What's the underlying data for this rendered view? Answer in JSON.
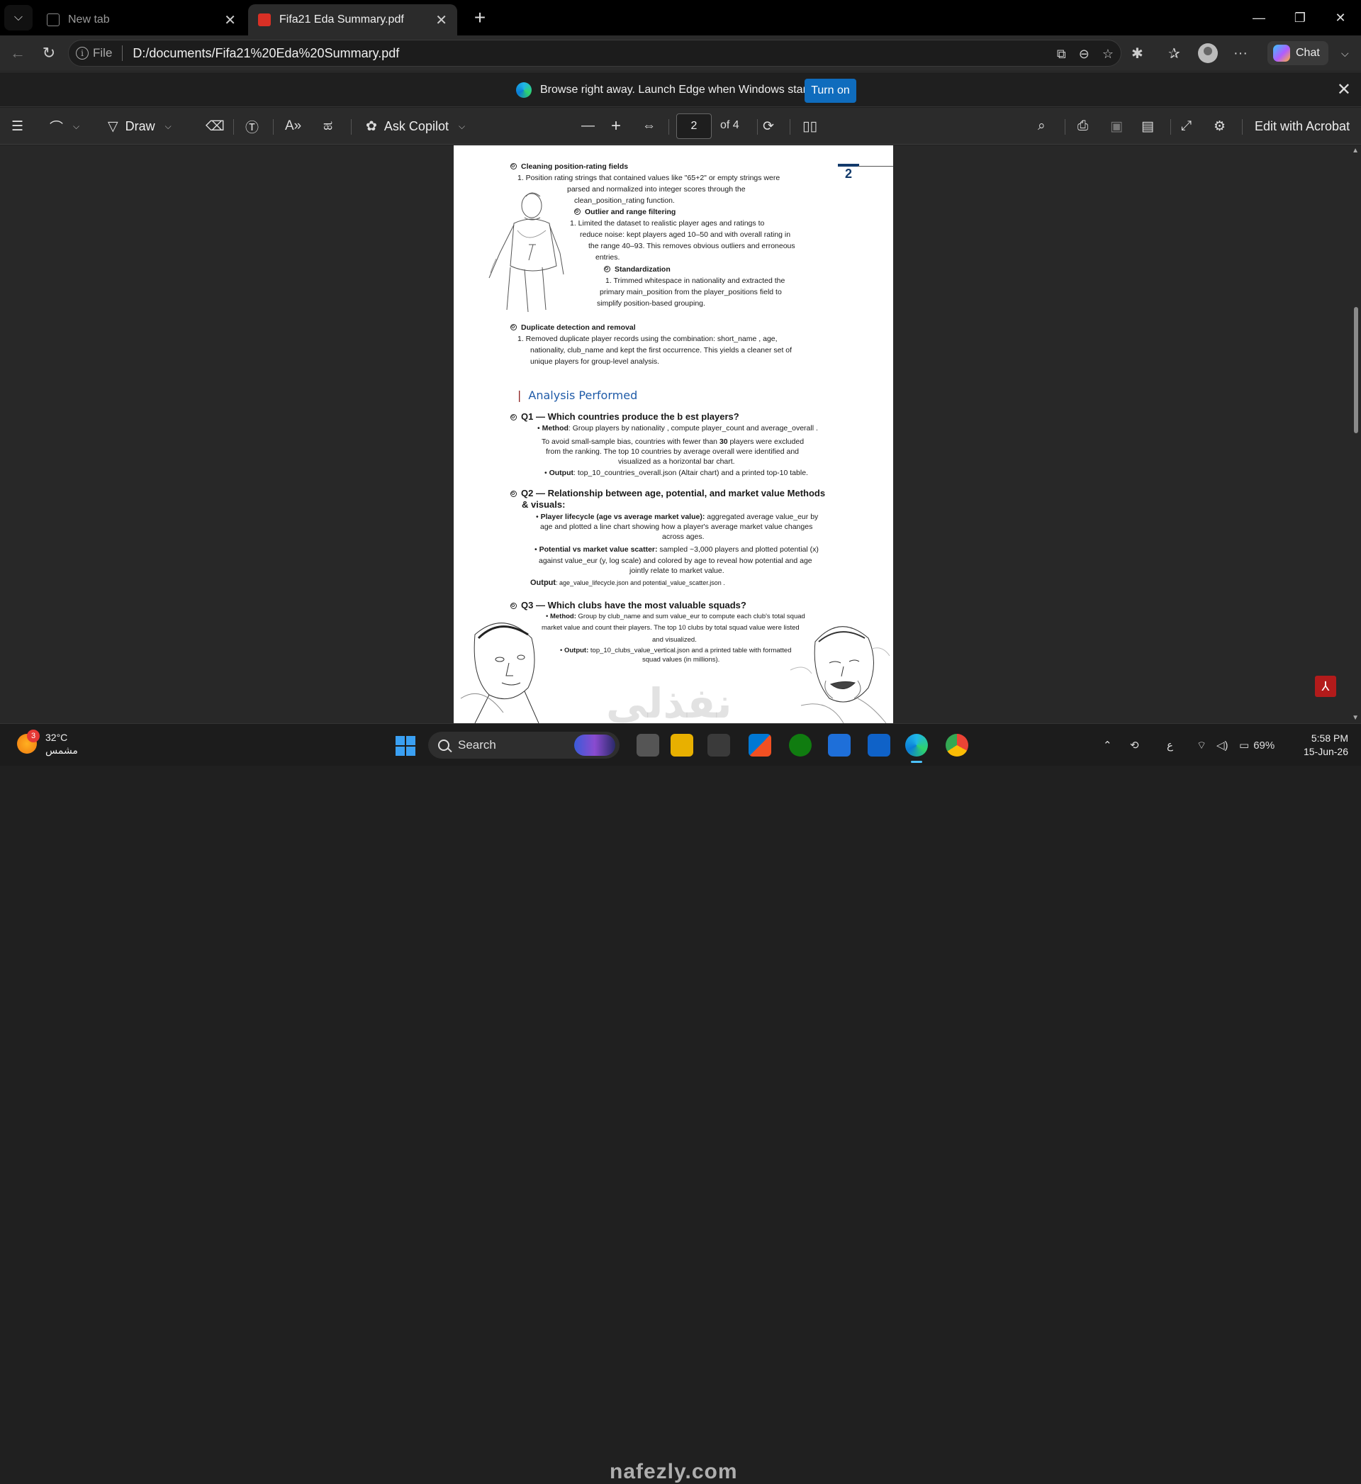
{
  "tabs": [
    {
      "title": "New tab",
      "active": false
    },
    {
      "title": "Fifa21 Eda Summary.pdf",
      "active": true
    }
  ],
  "address": {
    "scheme_label": "File",
    "url": "D:/documents/Fifa21%20Eda%20Summary.pdf"
  },
  "chat_label": "Chat",
  "infobar": {
    "message": "Browse right away. Launch Edge when Windows starts.",
    "button": "Turn on"
  },
  "pdf_toolbar": {
    "draw_label": "Draw",
    "ask_copilot_label": "Ask Copilot",
    "current_page": "2",
    "page_of": "of 4",
    "edit_acrobat_label": "Edit with Acrobat"
  },
  "document": {
    "page_number": "2",
    "sections": {
      "s1_title": "Cleaning position-rating fields",
      "s1_l1": "1.    Position rating strings that contained values like \"65+2\" or empty strings were",
      "s1_l2": "parsed and normalized into integer scores through the",
      "s1_l3": "clean_position_rating function.",
      "s2_title": "Outlier and range filtering",
      "s2_l1": "1.       Limited the dataset to realistic player ages and ratings to",
      "s2_l2": "reduce noise: kept players aged 10–50 and with overall rating in",
      "s2_l3": "the range 40–93. This removes obvious outliers and erroneous",
      "s2_l4": "entries.",
      "s3_title": "Standardization",
      "s3_l1": "1.    Trimmed whitespace in nationality and extracted the",
      "s3_l2": "primary main_position from the player_positions field to",
      "s3_l3": "simplify position-based grouping.",
      "s4_title": "Duplicate detection and removal",
      "s4_l1": "1.    Removed duplicate player records using the combination: short_name , age,",
      "s4_l2": "nationality, club_name and kept the first occurrence. This yields a cleaner set of",
      "s4_l3": "unique players for group-level analysis.",
      "analysis_title": "Analysis Performed",
      "q1_title": "Q1 — Which countries produce the b est players?",
      "q1_method_label": "Method",
      "q1_method": ": Group players by nationality , compute player_count and average_overall .",
      "q1_l2a": "To avoid small-sample bias, countries with fewer than ",
      "q1_l2b": "30",
      "q1_l2c": " players were excluded",
      "q1_l3": "from the ranking. The top 10 countries by average overall were identified and",
      "q1_l4": "visualized as a horizontal bar chart.",
      "q1_output_label": "Output",
      "q1_output": ": top_10_countries_overall.json (Altair chart) and a printed top-10 table.",
      "q2_title_l1": "Q2 — Relationship between age, potential, and market value Methods",
      "q2_title_l2": "& visuals:",
      "q2_b1_label": "Player lifecycle (age vs average market value):",
      "q2_b1_l1": " aggregated average value_eur by",
      "q2_b1_l2": "age and plotted a line chart showing how a player's average market value changes",
      "q2_b1_l3": "across ages.",
      "q2_b2_label": "Potential vs market value scatter:",
      "q2_b2_l1": " sampled ~3,000 players and plotted potential (x)",
      "q2_b2_l2": "against value_eur (y, log scale) and colored by age to reveal how potential and age",
      "q2_b2_l3": "jointly relate to market value.",
      "q2_output_label": "Output",
      "q2_output": ": age_value_lifecycle.json and potential_value_scatter.json .",
      "q3_title": "Q3 — Which clubs have the most valuable squads?",
      "q3_method_label": "Method:",
      "q3_m1": " Group by club_name and sum value_eur to compute each club's total squad",
      "q3_m2": "market value and count their players. The top 10 clubs by total squad value were listed",
      "q3_m3": "and visualized.",
      "q3_output_label": "Output:",
      "q3_o1": " top_10_clubs_value_vertical.json and a printed table with formatted",
      "q3_o2": "squad values (in millions)."
    }
  },
  "watermark": {
    "arabic": "نفذلي",
    "latin": "nafezly.com"
  },
  "taskbar": {
    "weather_temp": "32°C",
    "weather_desc": "مشمس",
    "weather_badge": "3",
    "search_label": "Search",
    "battery": "69%",
    "lang": "ع",
    "time": "5:58 PM",
    "date": "15-Jun-26"
  },
  "colors": {
    "accent": "#0f6cbd",
    "pdf_heading": "#1f5ba8",
    "page_number": "#123a6b"
  },
  "icons": [
    "tab-actions-icon",
    "pdf-icon",
    "back-icon",
    "refresh-icon",
    "info-icon",
    "immersive-reader-icon",
    "zoom-out-icon",
    "favorite-star-icon",
    "extensions-icon",
    "favorites-icon",
    "profile-icon",
    "more-icon",
    "contents-icon",
    "highlight-icon",
    "draw-icon",
    "eraser-icon",
    "text-box-icon",
    "read-aloud-icon",
    "translate-icon",
    "copilot-icon",
    "minus-icon",
    "plus-icon",
    "fit-width-icon",
    "rotate-icon",
    "page-view-icon",
    "search-icon",
    "print-icon",
    "save-icon",
    "save-as-icon",
    "fullscreen-icon",
    "settings-icon"
  ]
}
